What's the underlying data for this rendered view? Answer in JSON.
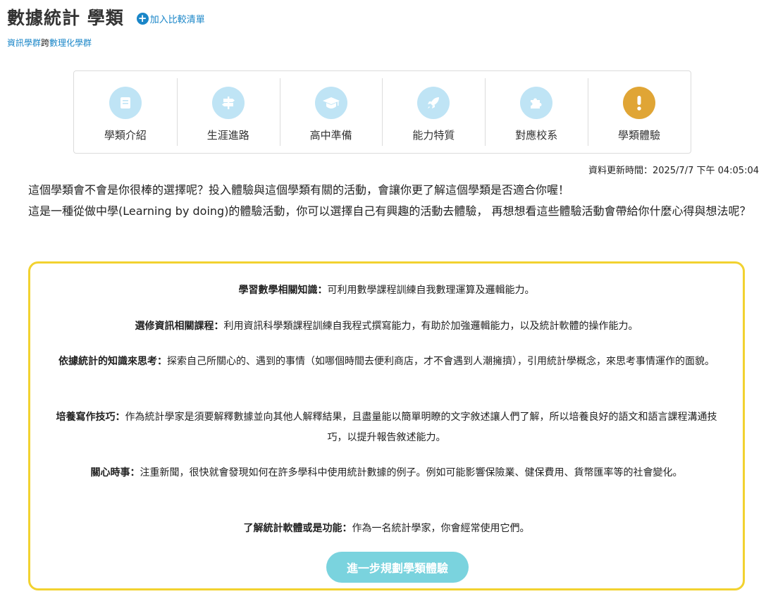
{
  "header": {
    "title": "數據統計 學類",
    "compare_label": "加入比較清單"
  },
  "breadcrumb": [
    "資訊學群",
    "跨",
    "數理化學群"
  ],
  "nav": [
    {
      "label": "學類介紹",
      "icon": "book-icon"
    },
    {
      "label": "生涯進路",
      "icon": "signpost-icon"
    },
    {
      "label": "高中準備",
      "icon": "graduation-cap-icon"
    },
    {
      "label": "能力特質",
      "icon": "rocket-icon"
    },
    {
      "label": "對應校系",
      "icon": "puzzle-icon"
    },
    {
      "label": "學類體驗",
      "icon": "exclamation-icon",
      "active": true
    }
  ],
  "colors": {
    "nav_icon_bg": "#bfe4f5",
    "nav_icon_active": "#e0a535",
    "box_border": "#f2d230",
    "cta_bg": "#7ad3de",
    "link": "#1a86c8"
  },
  "update_time": "資料更新時間：2025/7/7 下午 04:05:04",
  "intro": {
    "p1": "這個學類會不會是你很棒的選擇呢？投入體驗與這個學類有關的活動，會讓你更了解這個學類是否適合你喔！",
    "p2": "這是一種從做中學(Learning by doing)的體驗活動，你可以選擇自己有興趣的活動去體驗， 再想想看這些體驗活動會帶給你什麼心得與想法呢？"
  },
  "experiences": [
    {
      "title": "學習數學相關知識：",
      "text": "可利用數學課程訓練自我數理運算及邏輯能力。"
    },
    {
      "title": "選修資訊相關課程：",
      "text": "利用資訊科學類課程訓練自我程式撰寫能力，有助於加強邏輯能力，以及統計軟體的操作能力。"
    },
    {
      "title": "依據統計的知識來思考：",
      "text": "探索自己所關心的、遇到的事情（如哪個時間去便利商店，才不會遇到人潮擁擠），引用統計學概念，來思考事情運作的面貌。"
    },
    {
      "title": "培養寫作技巧：",
      "text": "作為統計學家是須要解釋數據並向其他人解釋結果，且盡量能以簡單明瞭的文字敘述讓人們了解，所以培養良好的語文和語言課程溝通技巧，以提升報告敘述能力。"
    },
    {
      "title": "關心時事：",
      "text": "注重新聞，很快就會發現如何在許多學科中使用統計數據的例子。例如可能影響保險業、健保費用、貨幣匯率等的社會變化。"
    },
    {
      "title": "了解統計軟體或是功能：",
      "text": "作為一名統計學家，你會經常使用它們。"
    }
  ],
  "cta_label": "進一步規劃學類體驗"
}
